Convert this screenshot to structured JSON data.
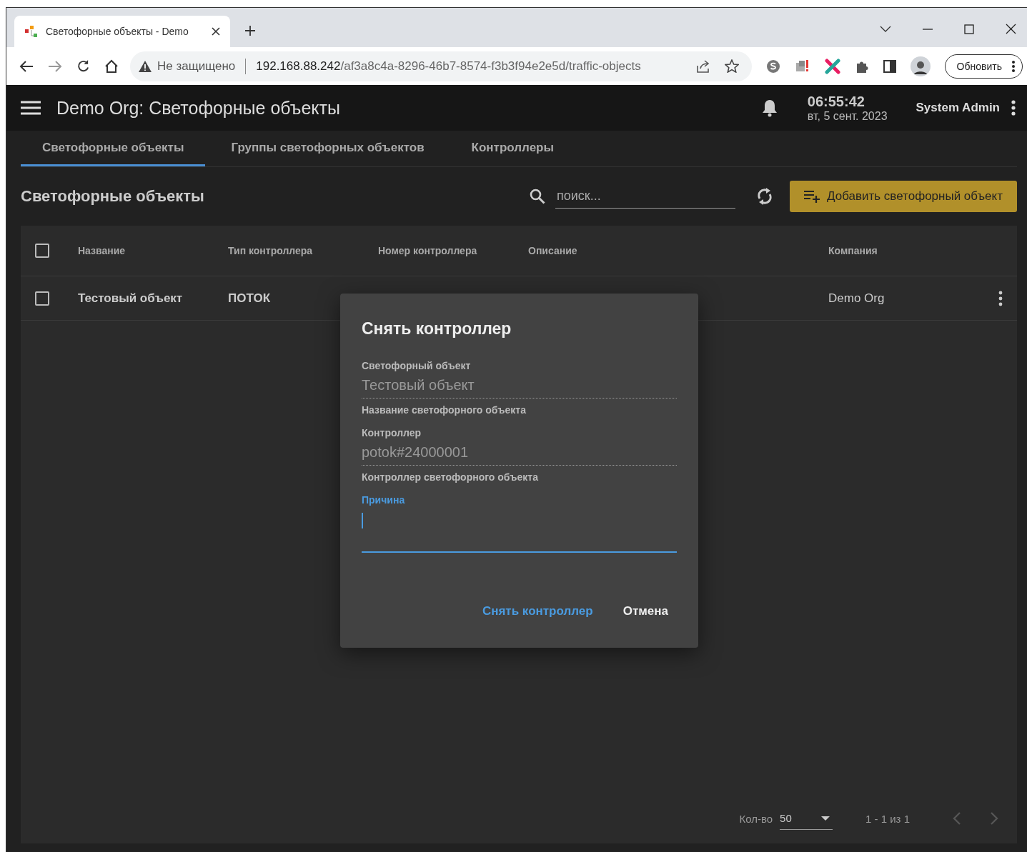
{
  "browser": {
    "tab": {
      "title": "Светофорные объекты - Demo",
      "selected": true
    },
    "security_label": "Не защищено",
    "url_host": "192.168.88.242",
    "url_path": "/af3a8c4a-8296-46b7-8574-f3b3f94e2e5d/traffic-objects",
    "update_button": "Обновить"
  },
  "header": {
    "title": "Demo Org: Светофорные объекты",
    "time": "06:55:42",
    "date": "вт, 5 сент. 2023",
    "user": "System Admin"
  },
  "tabs": [
    {
      "label": "Светофорные объекты",
      "selected": true
    },
    {
      "label": "Группы светофорных объектов",
      "selected": false
    },
    {
      "label": "Контроллеры",
      "selected": false
    }
  ],
  "section_title": "Светофорные объекты",
  "search": {
    "placeholder": "поиск..."
  },
  "add_button": "Добавить светофорный объект",
  "table": {
    "select_all_checked": false,
    "columns": [
      "Название",
      "Тип контроллера",
      "Номер контроллера",
      "Описание",
      "Компания"
    ],
    "rows": [
      {
        "name": "Тестовый объект",
        "controller_type": "ПОТОК",
        "company": "Demo Org",
        "checked": false
      }
    ]
  },
  "pagination": {
    "page_size_label": "Кол-во",
    "page_size": "50",
    "range": "1 - 1 из 1"
  },
  "dialog": {
    "title": "Снять контроллер",
    "fields": [
      {
        "label": "Светофорный объект",
        "value": "Тестовый объект",
        "hint": "Название светофорного объекта"
      },
      {
        "label": "Контроллер",
        "value": "potok#24000001",
        "hint": "Контроллер светофорного объекта"
      }
    ],
    "reason": {
      "label": "Причина",
      "focused": true
    },
    "buttons": [
      {
        "label": "Снять контроллер",
        "kind": "primary"
      },
      {
        "label": "Отмена",
        "kind": "plain"
      }
    ]
  }
}
